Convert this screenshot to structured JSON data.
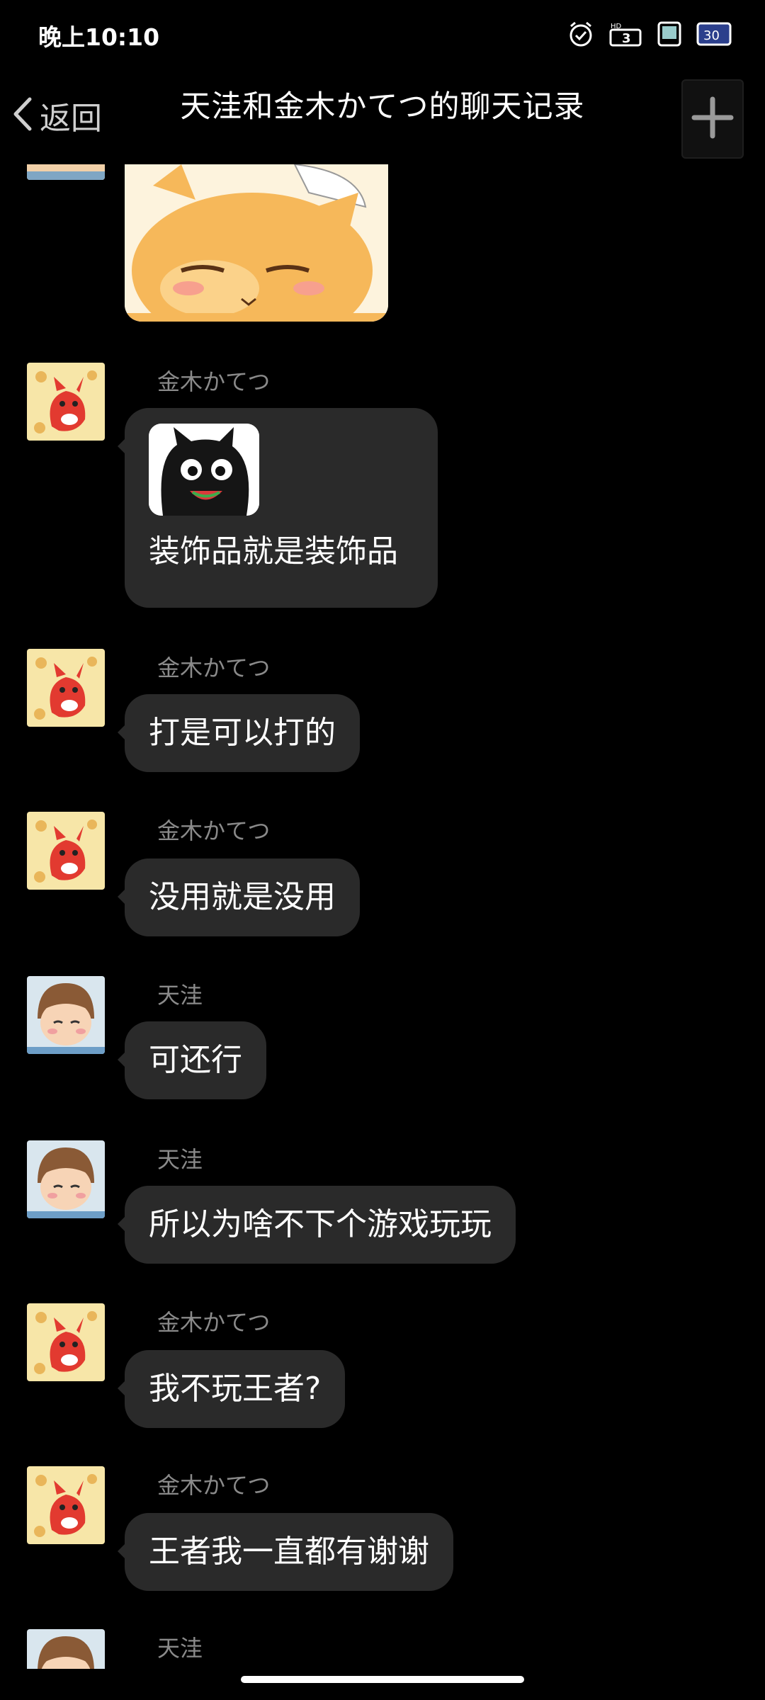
{
  "status_bar": {
    "time": "晚上10:10",
    "icons": [
      "alarm-icon",
      "hd-signal-icon",
      "sim-card-icon",
      "battery-icon"
    ],
    "battery_level": "30"
  },
  "nav": {
    "back_label": "返回",
    "title": "天洼和金木かてつ的聊天记录"
  },
  "messages": [
    {
      "sender": "金木かてつ",
      "avatar": "fox-avatar",
      "sticker": "black-cat-sticker",
      "text": "装饰品就是装饰品"
    },
    {
      "sender": "金木かてつ",
      "avatar": "fox-avatar",
      "text": "打是可以打的"
    },
    {
      "sender": "金木かてつ",
      "avatar": "fox-avatar",
      "text": "没用就是没用"
    },
    {
      "sender": "天洼",
      "avatar": "boy-avatar",
      "text": "可还行"
    },
    {
      "sender": "天洼",
      "avatar": "boy-avatar",
      "text": "所以为啥不下个游戏玩玩"
    },
    {
      "sender": "金木かてつ",
      "avatar": "fox-avatar",
      "text": "我不玩王者?"
    },
    {
      "sender": "金木かてつ",
      "avatar": "fox-avatar",
      "text": "王者我一直都有谢谢"
    },
    {
      "sender": "天洼",
      "avatar": "boy-avatar"
    }
  ],
  "colors": {
    "background": "#000000",
    "bubble": "#2a2a2a",
    "sender_name": "#8a8a8a",
    "text": "#ffffff"
  }
}
